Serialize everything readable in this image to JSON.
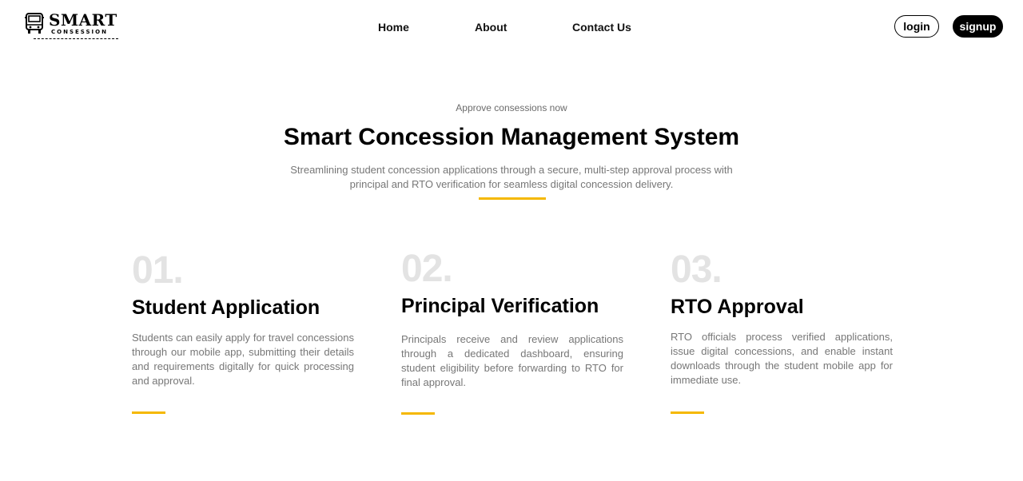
{
  "brand": {
    "title": "SMART",
    "subtitle": "CONSESSION"
  },
  "nav": {
    "home": "Home",
    "about": "About",
    "contact": "Contact Us"
  },
  "auth": {
    "login": "login",
    "signup": "signup"
  },
  "hero": {
    "eyebrow": "Approve consessions now",
    "title": "Smart Concession Management System",
    "description": "Streamlining student concession applications through a secure, multi-step approval process with principal and RTO verification for seamless digital concession delivery."
  },
  "steps": [
    {
      "number": "01.",
      "title": "Student Application",
      "text": "Students can easily apply for travel concessions through our mobile app, submitting their details and requirements digitally for quick processing and approval."
    },
    {
      "number": "02.",
      "title": "Principal Verification",
      "text": "Principals receive and review applications through a dedicated dashboard, ensuring student eligibility before forwarding to RTO for final approval."
    },
    {
      "number": "03.",
      "title": "RTO Approval",
      "text": "RTO officials process verified applications, issue digital concessions, and enable instant downloads through the student mobile app for immediate use."
    }
  ],
  "colors": {
    "accent": "#f5b800",
    "text_muted": "#777777",
    "number_muted": "#e3e3e3"
  },
  "icons": {
    "logo": "bus-icon"
  }
}
